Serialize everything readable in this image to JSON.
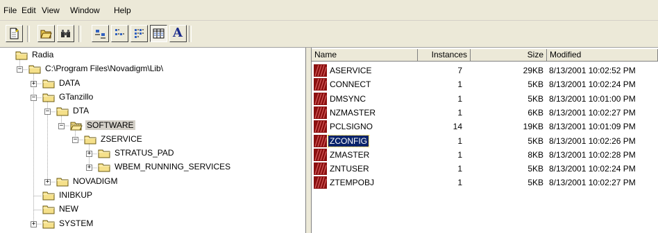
{
  "menu": [
    "File",
    "Edit",
    "View",
    "Window",
    "Help"
  ],
  "toolbar": {
    "buttons": [
      {
        "icon": "new-document-icon",
        "pressed": false
      },
      {
        "icon": "open-folder-icon",
        "pressed": false
      },
      {
        "icon": "find-binoculars-icon",
        "pressed": false
      },
      {
        "icon": "large-icons-view-icon",
        "pressed": false
      },
      {
        "icon": "small-icons-view-icon",
        "pressed": false
      },
      {
        "icon": "list-view-icon",
        "pressed": false
      },
      {
        "icon": "details-view-icon",
        "pressed": true
      },
      {
        "icon": "font-icon",
        "pressed": false,
        "glyph": "A"
      }
    ]
  },
  "tree": [
    {
      "label": "Radia",
      "level": 0,
      "toggle": "none",
      "open": false,
      "selected": false
    },
    {
      "label": "C:\\Program Files\\Novadigm\\Lib\\",
      "level": 1,
      "toggle": "minus",
      "open": false,
      "selected": false
    },
    {
      "label": "DATA",
      "level": 2,
      "toggle": "plus",
      "open": false,
      "selected": false
    },
    {
      "label": "GTanzillo",
      "level": 2,
      "toggle": "minus",
      "open": false,
      "selected": false
    },
    {
      "label": "DTA",
      "level": 3,
      "toggle": "minus",
      "open": false,
      "selected": false
    },
    {
      "label": "SOFTWARE",
      "level": 4,
      "toggle": "minus",
      "open": true,
      "selected": true
    },
    {
      "label": "ZSERVICE",
      "level": 5,
      "toggle": "minus",
      "open": false,
      "selected": false
    },
    {
      "label": "STRATUS_PAD",
      "level": 6,
      "toggle": "plus",
      "open": false,
      "selected": false
    },
    {
      "label": "WBEM_RUNNING_SERVICES",
      "level": 6,
      "toggle": "plus",
      "open": false,
      "selected": false
    },
    {
      "label": "NOVADIGM",
      "level": 3,
      "toggle": "plus",
      "open": false,
      "selected": false
    },
    {
      "label": "INIBKUP",
      "level": 2,
      "toggle": "none",
      "open": false,
      "selected": false
    },
    {
      "label": "NEW",
      "level": 2,
      "toggle": "none",
      "open": false,
      "selected": false
    },
    {
      "label": "SYSTEM",
      "level": 2,
      "toggle": "plus",
      "open": false,
      "selected": false
    }
  ],
  "list": {
    "columns": [
      "Name",
      "Instances",
      "Size",
      "Modified"
    ],
    "rows": [
      {
        "name": "ASERVICE",
        "instances": "7",
        "size": "29KB",
        "modified": "8/13/2001 10:02:52 PM",
        "selected": false
      },
      {
        "name": "CONNECT",
        "instances": "1",
        "size": "5KB",
        "modified": "8/13/2001 10:02:24 PM",
        "selected": false
      },
      {
        "name": "DMSYNC",
        "instances": "1",
        "size": "5KB",
        "modified": "8/13/2001 10:01:00 PM",
        "selected": false
      },
      {
        "name": "NZMASTER",
        "instances": "1",
        "size": "6KB",
        "modified": "8/13/2001 10:02:27 PM",
        "selected": false
      },
      {
        "name": "PCLSIGNO",
        "instances": "14",
        "size": "19KB",
        "modified": "8/13/2001 10:01:09 PM",
        "selected": false
      },
      {
        "name": "ZCONFIG",
        "instances": "1",
        "size": "5KB",
        "modified": "8/13/2001 10:02:26 PM",
        "selected": true
      },
      {
        "name": "ZMASTER",
        "instances": "1",
        "size": "8KB",
        "modified": "8/13/2001 10:02:28 PM",
        "selected": false
      },
      {
        "name": "ZNTUSER",
        "instances": "1",
        "size": "5KB",
        "modified": "8/13/2001 10:02:24 PM",
        "selected": false
      },
      {
        "name": "ZTEMPOBJ",
        "instances": "1",
        "size": "5KB",
        "modified": "8/13/2001 10:02:27 PM",
        "selected": false
      }
    ]
  },
  "colors": {
    "selection": "#0a246a",
    "object_icon": "#8b1010",
    "folder": "#f5e08a"
  }
}
